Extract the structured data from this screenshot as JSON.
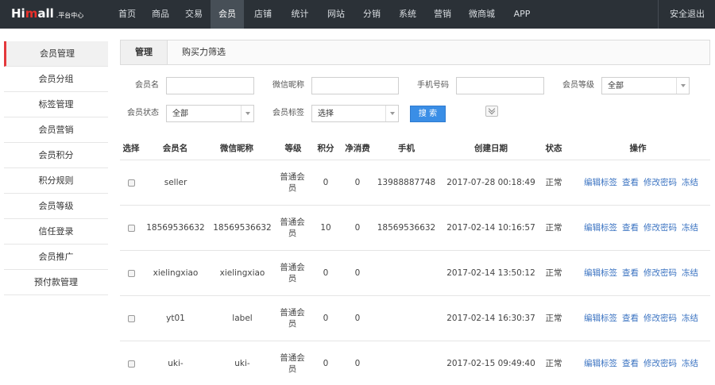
{
  "brand": {
    "logo_left": "Hi",
    "logo_red": "m",
    "logo_right": "all",
    "logo_sub": ".平台中心"
  },
  "nav": {
    "items": [
      "首页",
      "商品",
      "交易",
      "会员",
      "店铺",
      "统计",
      "网站",
      "分销",
      "系统",
      "营销",
      "微商城",
      "APP"
    ],
    "active": "会员",
    "logout": "安全退出"
  },
  "sidebar": {
    "items": [
      "会员管理",
      "会员分组",
      "标签管理",
      "会员营销",
      "会员积分",
      "积分规则",
      "会员等级",
      "信任登录",
      "会员推广",
      "预付款管理"
    ],
    "active": "会员管理"
  },
  "tabs": [
    "管理",
    "购买力筛选"
  ],
  "filters": {
    "member_name_label": "会员名",
    "member_name_value": "",
    "wechat_label": "微信昵称",
    "wechat_value": "",
    "phone_label": "手机号码",
    "phone_value": "",
    "level_label": "会员等级",
    "level_value": "全部",
    "status_label": "会员状态",
    "status_value": "全部",
    "tag_label": "会员标签",
    "tag_value": "选择",
    "search_button": "搜 索",
    "expand_icon": "double-chevron-down-icon"
  },
  "table": {
    "headers": [
      "选择",
      "会员名",
      "微信昵称",
      "等级",
      "积分",
      "净消费",
      "手机",
      "创建日期",
      "状态",
      "操作"
    ],
    "rows": [
      {
        "name": "seller",
        "wechat": "",
        "level": "普通会员",
        "points": "0",
        "net": "0",
        "phone": "13988887748",
        "created": "2017-07-28 00:18:49",
        "status": "正常"
      },
      {
        "name": "18569536632",
        "wechat": "18569536632",
        "level": "普通会员",
        "points": "10",
        "net": "0",
        "phone": "18569536632",
        "created": "2017-02-14 10:16:57",
        "status": "正常"
      },
      {
        "name": "xielingxiao",
        "wechat": "xielingxiao",
        "level": "普通会员",
        "points": "0",
        "net": "0",
        "phone": "",
        "created": "2017-02-14 13:50:12",
        "status": "正常"
      },
      {
        "name": "yt01",
        "wechat": "label",
        "level": "普通会员",
        "points": "0",
        "net": "0",
        "phone": "",
        "created": "2017-02-14 16:30:37",
        "status": "正常"
      },
      {
        "name": "uki-",
        "wechat": "uki-",
        "level": "普通会员",
        "points": "0",
        "net": "0",
        "phone": "",
        "created": "2017-02-15 09:49:40",
        "status": "正常"
      }
    ],
    "actions": [
      "编辑标签",
      "查看",
      "修改密码",
      "冻结"
    ]
  },
  "colors": {
    "topbar": "#2b3137",
    "accent_red": "#e4393c",
    "link_blue": "#3c74c2",
    "button_blue": "#3a8ee6"
  }
}
